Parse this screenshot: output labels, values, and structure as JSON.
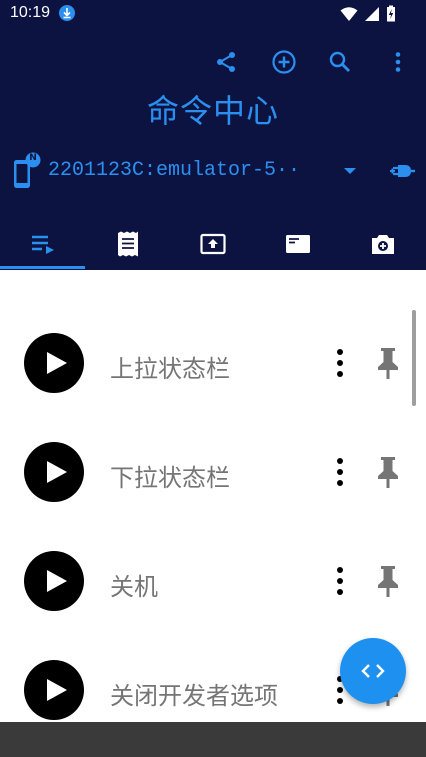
{
  "status_bar": {
    "time": "10:19",
    "icons": [
      "download-icon",
      "wifi-icon",
      "signal-icon",
      "battery-charging-icon"
    ]
  },
  "toolbar": {
    "actions": [
      "share-icon",
      "add-circle-icon",
      "search-icon",
      "more-vert-icon"
    ]
  },
  "header": {
    "title": "命令中心"
  },
  "device": {
    "name": "2201123C:emulator-5··",
    "badge": "N"
  },
  "tabs": [
    {
      "icon": "playlist-icon",
      "selected": true
    },
    {
      "icon": "receipt-icon",
      "selected": false
    },
    {
      "icon": "upload-box-icon",
      "selected": false
    },
    {
      "icon": "card-icon",
      "selected": false
    },
    {
      "icon": "camera-add-icon",
      "selected": false
    }
  ],
  "commands": [
    {
      "label": "上拉状态栏"
    },
    {
      "label": "下拉状态栏"
    },
    {
      "label": "关机"
    },
    {
      "label": "关闭开发者选项"
    }
  ],
  "colors": {
    "header_bg": "#0c1340",
    "accent": "#2b8ff0",
    "fab": "#1e90f0",
    "label_text": "#757575"
  }
}
